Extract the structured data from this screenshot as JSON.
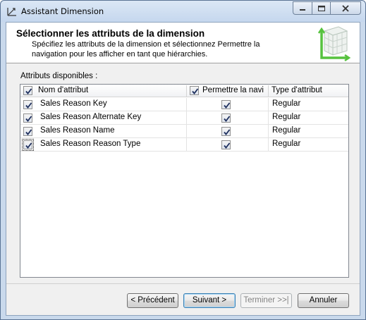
{
  "window": {
    "title": "Assistant Dimension"
  },
  "header": {
    "title": "Sélectionner les attributs de la dimension",
    "description": "Spécifiez les attributs de la dimension et sélectionnez Permettre la navigation pour les afficher en tant que hiérarchies."
  },
  "attributes": {
    "label": "Attributs disponibles :",
    "columns": {
      "name": "Nom d'attribut",
      "browse": "Permettre la navi",
      "type": "Type d'attribut"
    },
    "header_checked": true,
    "header_browse_checked": true,
    "rows": [
      {
        "checked": true,
        "name": "Sales Reason Key",
        "browse": true,
        "type": "Regular"
      },
      {
        "checked": true,
        "name": "Sales Reason Alternate Key",
        "browse": true,
        "type": "Regular"
      },
      {
        "checked": true,
        "name": "Sales Reason Name",
        "browse": true,
        "type": "Regular"
      },
      {
        "checked": true,
        "name": "Sales Reason Reason Type",
        "browse": true,
        "type": "Regular"
      }
    ]
  },
  "buttons": {
    "back": "< Précédent",
    "next": "Suivant >",
    "finish": "Terminer >>|",
    "cancel": "Annuler"
  },
  "colors": {
    "accent": "#3c7fb1",
    "frame": "#c9d9ec"
  },
  "icons": {
    "app": "dimension-wizard-icon",
    "header": "dimension-cube-icon"
  }
}
